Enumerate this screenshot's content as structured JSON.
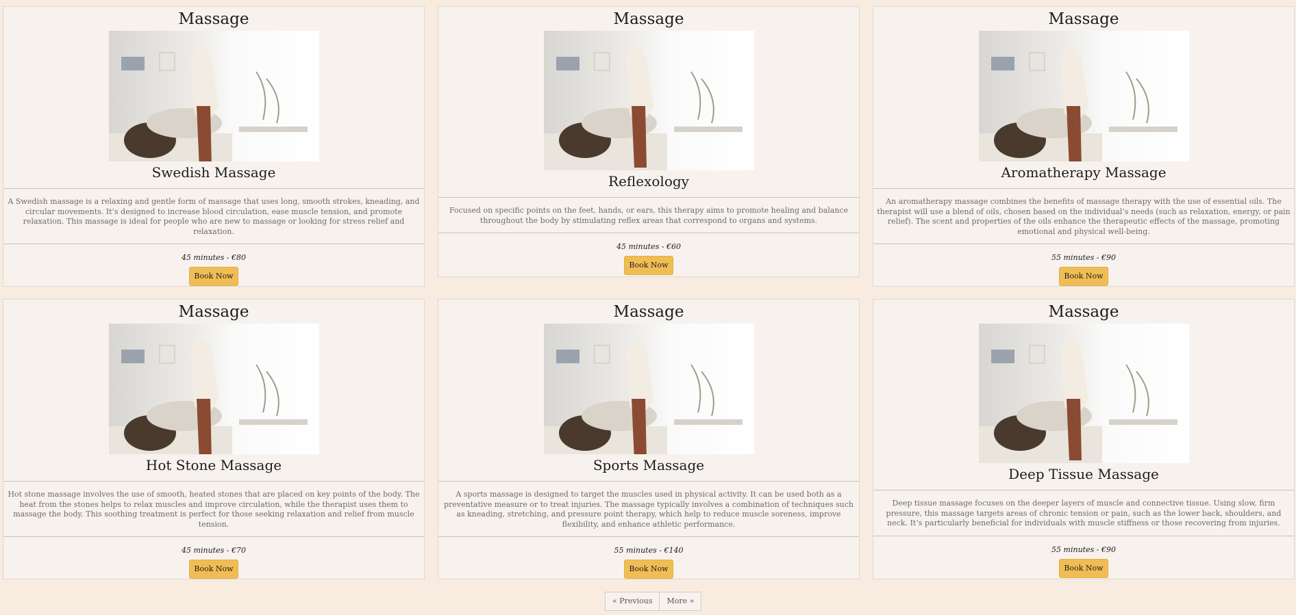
{
  "cards": [
    {
      "title": "Massage",
      "subtitle": "Swedish Massage",
      "description": "A Swedish massage is a relaxing and gentle form of massage that uses long, smooth strokes, kneading, and circular movements. It’s designed to increase blood circulation, ease muscle tension, and promote relaxation. This massage is ideal for people who are new to massage or looking for stress relief and relaxation.",
      "price": "45 minutes - €80",
      "button": "Book Now"
    },
    {
      "title": "Massage",
      "subtitle": "Reflexology",
      "description": "Focused on specific points on the feet, hands, or ears, this therapy aims to promote healing and balance throughout the body by stimulating reflex areas that correspond to organs and systems.",
      "price": "45 minutes - €60",
      "button": "Book Now"
    },
    {
      "title": "Massage",
      "subtitle": "Aromatherapy Massage",
      "description": "An aromatherapy massage combines the benefits of massage therapy with the use of essential oils. The therapist will use a blend of oils, chosen based on the individual’s needs (such as relaxation, energy, or pain relief). The scent and properties of the oils enhance the therapeutic effects of the massage, promoting emotional and physical well-being.",
      "price": "55 minutes - €90",
      "button": "Book Now"
    },
    {
      "title": "Massage",
      "subtitle": "Hot Stone Massage",
      "description": "Hot stone massage involves the use of smooth, heated stones that are placed on key points of the body. The heat from the stones helps to relax muscles and improve circulation, while the therapist uses them to massage the body. This soothing treatment is perfect for those seeking relaxation and relief from muscle tension.",
      "price": "45 minutes - €70",
      "button": "Book Now"
    },
    {
      "title": "Massage",
      "subtitle": "Sports Massage",
      "description": "A sports massage is designed to target the muscles used in physical activity. It can be used both as a preventative measure or to treat injuries. The massage typically involves a combination of techniques such as kneading, stretching, and pressure point therapy, which help to reduce muscle soreness, improve flexibility, and enhance athletic performance.",
      "price": "55 minutes - €140",
      "button": "Book Now"
    },
    {
      "title": "Massage",
      "subtitle": "Deep Tissue Massage",
      "description": "Deep tissue massage focuses on the deeper layers of muscle and connective tissue. Using slow, firm pressure, this massage targets areas of chronic tension or pain, such as the lower back, shoulders, and neck. It’s particularly beneficial for individuals with muscle stiffness or those recovering from injuries.",
      "price": "55 minutes - €90",
      "button": "Book Now"
    }
  ],
  "pagination": {
    "previous": "« Previous",
    "more": "More »"
  },
  "colors": {
    "page_bg": "#f8ebe0",
    "card_bg": "#f7f2ee",
    "button_bg": "#f0bd54"
  }
}
